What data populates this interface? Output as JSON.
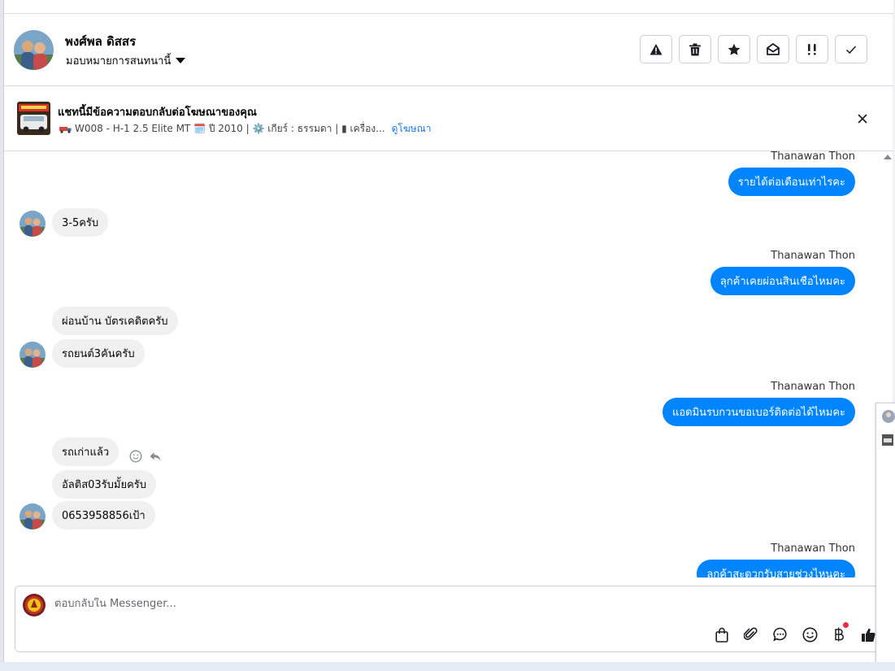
{
  "contact": {
    "name": "พงศ์พล ดิสสร",
    "assign_label": "มอบหมายการสนทนานี้"
  },
  "actions": [
    {
      "name": "report-spam-button",
      "icon": "warning-icon"
    },
    {
      "name": "delete-button",
      "icon": "trash-icon"
    },
    {
      "name": "star-button",
      "icon": "star-icon"
    },
    {
      "name": "mark-unread-button",
      "icon": "envelope-open-icon"
    },
    {
      "name": "follow-up-button",
      "icon": "priority-icon"
    },
    {
      "name": "mark-done-button",
      "icon": "check-icon"
    }
  ],
  "ad": {
    "title": "แชทนี้มีข้อความตอบกลับต่อโฆษณาของคุณ",
    "details": "W008 - H-1 2.5 Elite MT 🗓️ ปี 2010 | ⚙️ เกียร์ : ธรรมดา | ▮ เครื่อง...",
    "link": "ดูโฆษณา"
  },
  "messages": {
    "m1_sender": "Thanawan Thon",
    "m1": "รายได้ต่อเดือนเท่าไรคะ",
    "m2": "3-5ครับ",
    "m3_sender": "Thanawan Thon",
    "m3": "ลุกค้าเคยผ่อนสินเชือไหมคะ",
    "m4": "ผ่อนบ้าน บัตรเคดิตครับ",
    "m5": "รถยนต์3คันครับ",
    "m6_sender": "Thanawan Thon",
    "m6": "แอดมินรบกวนขอเบอร์ติดต่อได้ไหมคะ",
    "m7": "รถเก่าแล้ว",
    "m8": "อัลติส03รับมั้ยครับ",
    "m9": "0653958856เป้า",
    "m10_sender": "Thanawan Thon",
    "m10": "ลูกค้าสะดวกรับสายช่วงไหนคะ"
  },
  "composer": {
    "placeholder": "ตอบกลับใน Messenger..."
  },
  "colors": {
    "outgoing": "#0084ff",
    "incoming": "#f0f0f0",
    "link": "#1877f2",
    "notification_dot": "#f02849"
  }
}
